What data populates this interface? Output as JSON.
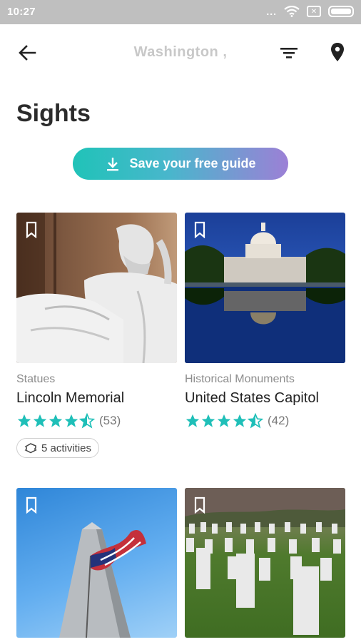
{
  "status_bar": {
    "time": "10:27",
    "dots": "...",
    "sim": "✕"
  },
  "app_bar": {
    "title": "Washington ,"
  },
  "page": {
    "title": "Sights"
  },
  "save_guide": {
    "label": "Save your free guide"
  },
  "colors": {
    "accent": "#1fbfb8",
    "gradient_end": "#9c80d6",
    "star": "#1fbfb8"
  },
  "cards": [
    {
      "category": "Statues",
      "title": "Lincoln Memorial",
      "rating": 4.5,
      "reviews": "(53)",
      "activities": "5 activities"
    },
    {
      "category": "Historical Monuments",
      "title": "United States Capitol",
      "rating": 4.5,
      "reviews": "(42)"
    },
    {
      "category": "",
      "title": ""
    },
    {
      "category": "",
      "title": ""
    }
  ]
}
